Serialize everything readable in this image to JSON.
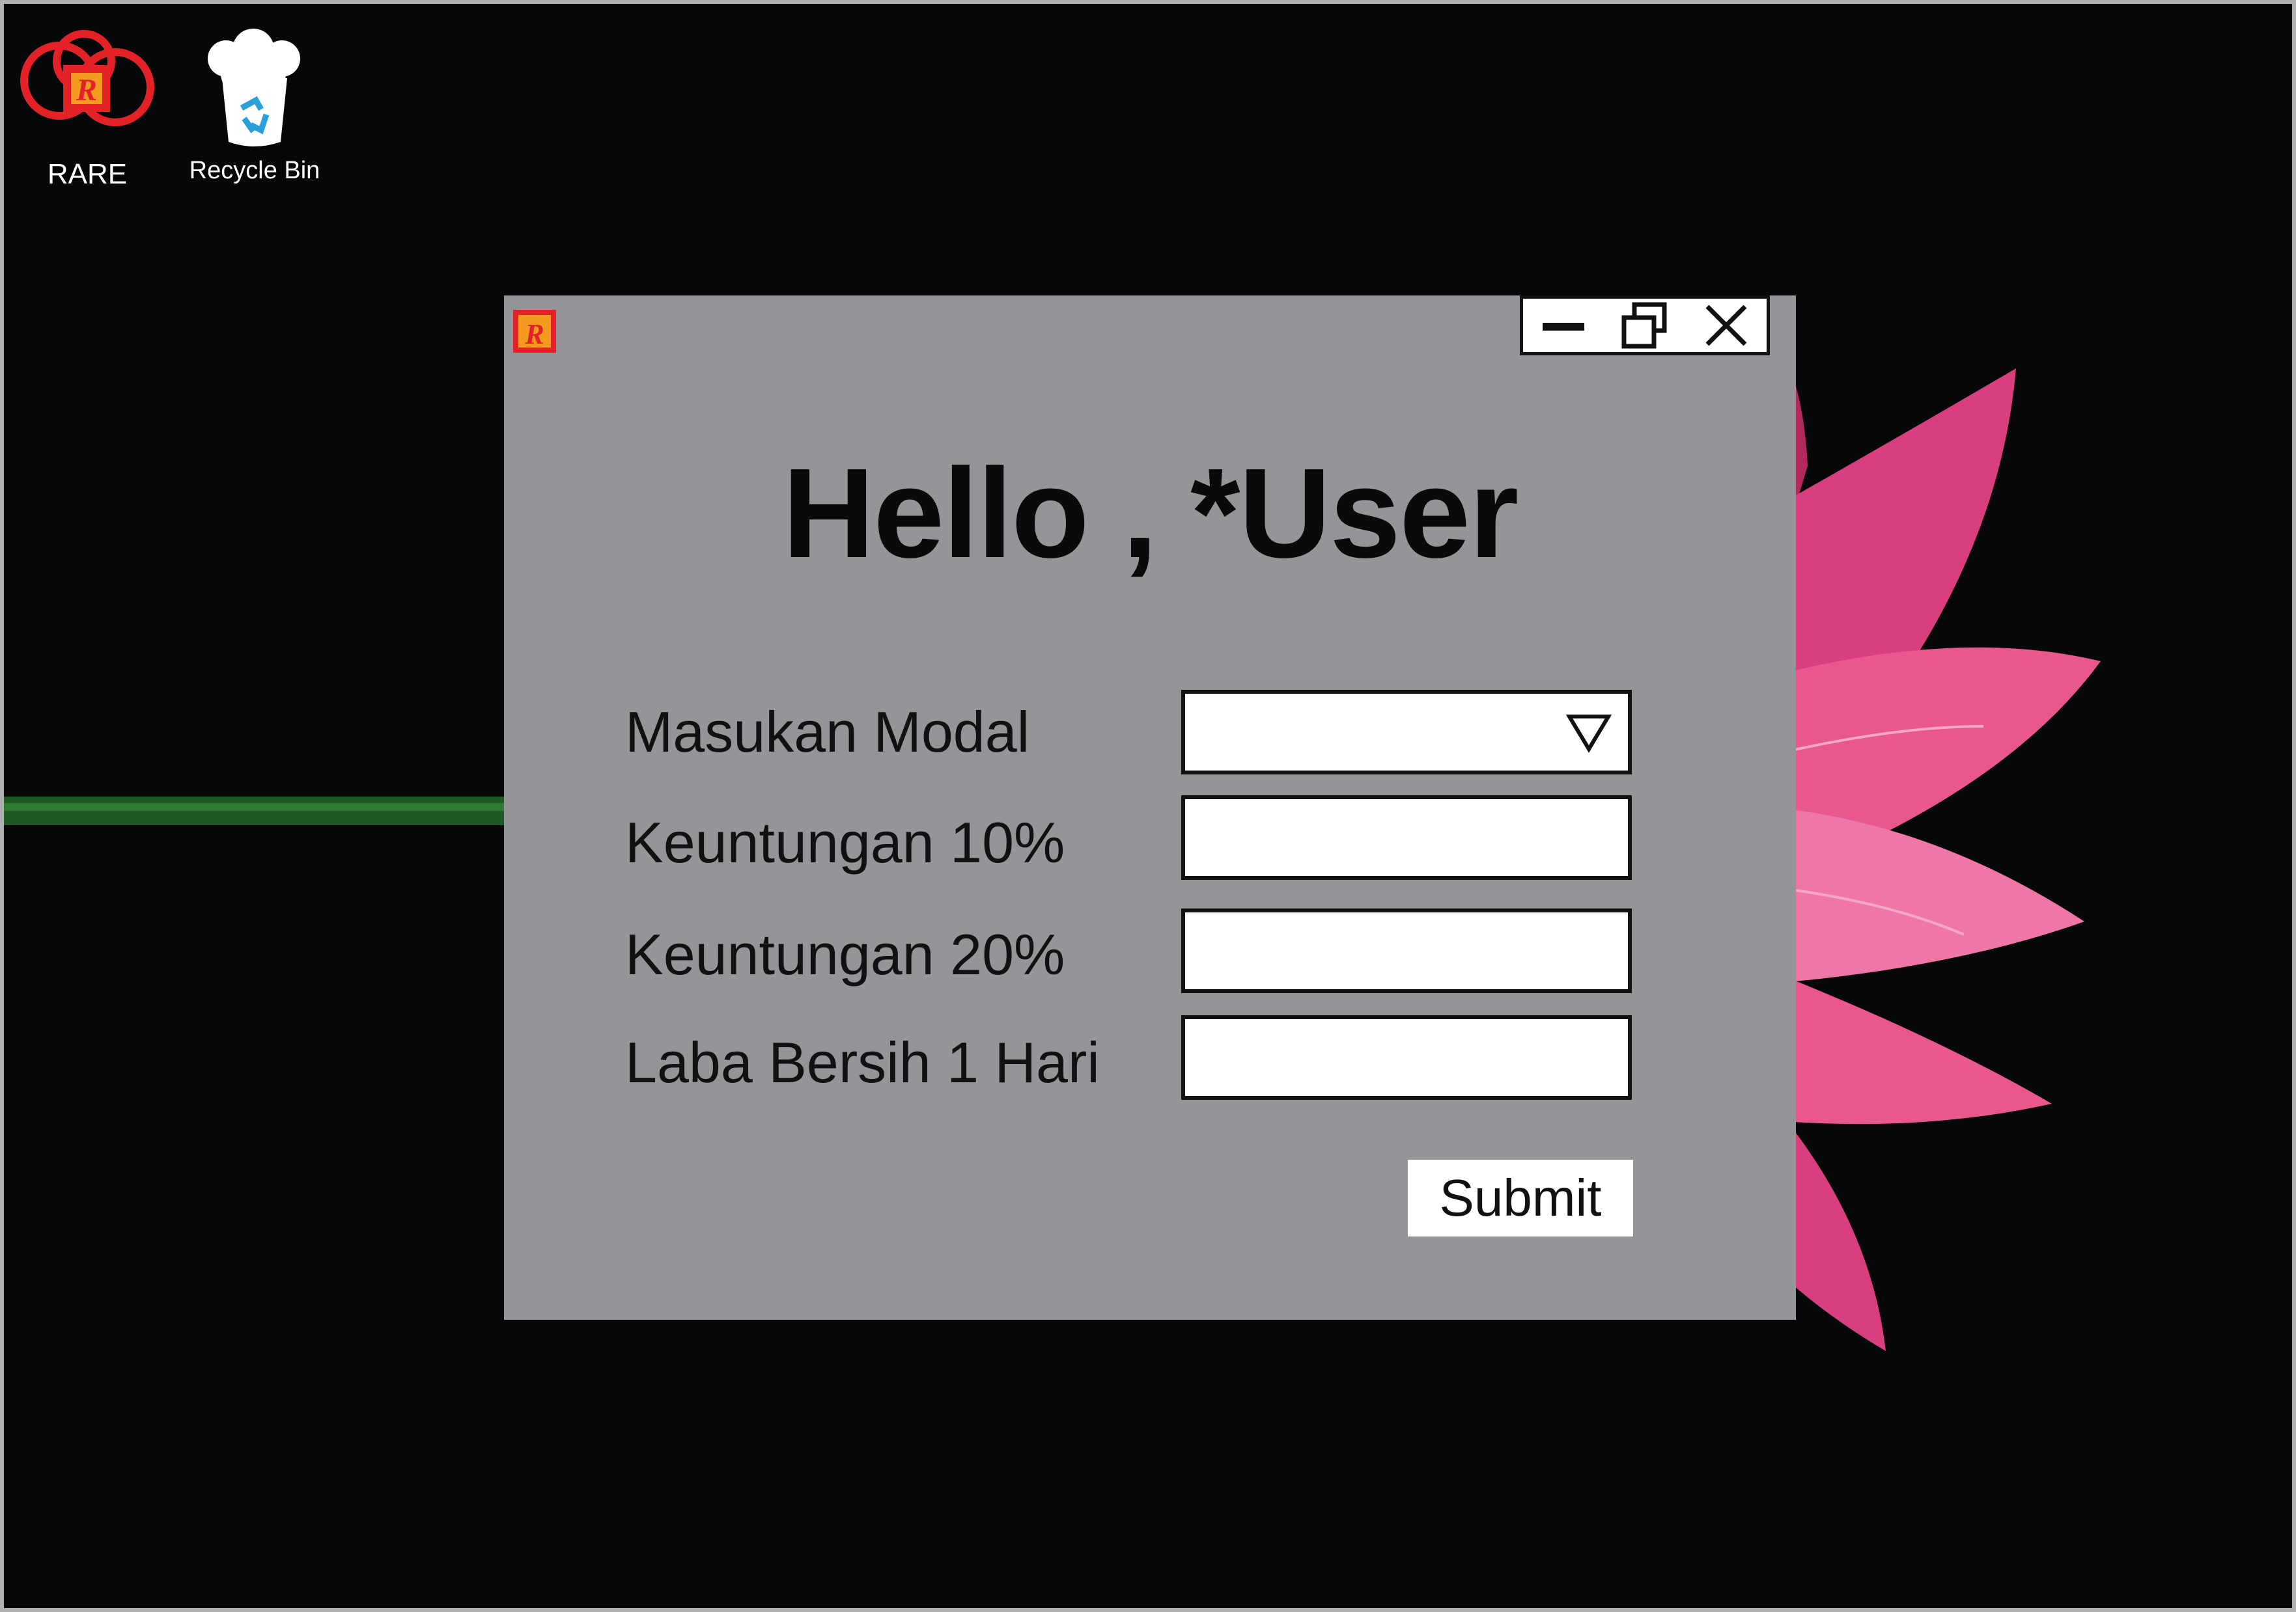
{
  "desktop": {
    "icons": [
      {
        "label": "RARE",
        "icon": "rare-app-icon"
      },
      {
        "label": "Recycle Bin",
        "icon": "recycle-bin-icon"
      }
    ]
  },
  "window": {
    "app_icon": "rare-app-icon",
    "controls": [
      "minimize-icon",
      "restore-icon",
      "close-icon"
    ],
    "greeting": "Hello , *User",
    "fields": [
      {
        "label": "Masukan Modal",
        "type": "dropdown",
        "value": ""
      },
      {
        "label": "Keuntungan 10%",
        "type": "text",
        "value": ""
      },
      {
        "label": "Keuntungan 20%",
        "type": "text",
        "value": ""
      },
      {
        "label": "Laba Bersih 1 Hari",
        "type": "text",
        "value": ""
      }
    ],
    "submit_label": "Submit"
  },
  "colors": {
    "desktop_bg": "#050708",
    "window_bg": "#939598",
    "field_bg": "#ffffff",
    "flower_pink": "#e8588f",
    "rare_red": "#e32227",
    "rare_orange": "#f39a1f"
  }
}
